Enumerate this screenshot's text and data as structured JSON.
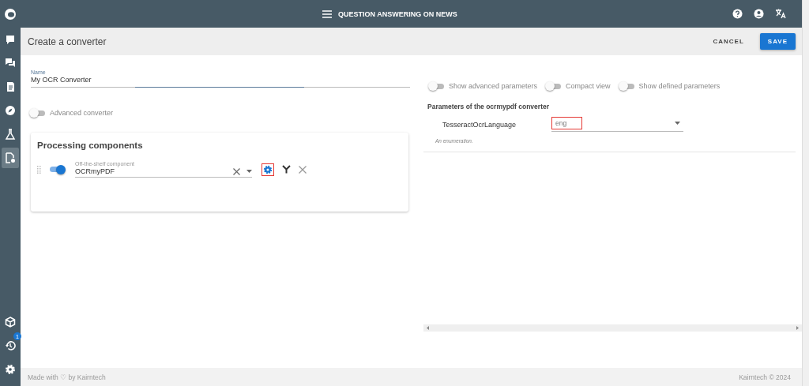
{
  "topbar": {
    "title": "QUESTION ANSWERING ON NEWS"
  },
  "sidebar": {
    "items": [
      {
        "kind": "question",
        "selected": false
      },
      {
        "kind": "chat",
        "selected": false
      },
      {
        "kind": "document",
        "selected": false
      },
      {
        "kind": "compass",
        "selected": false
      },
      {
        "kind": "flask",
        "selected": false
      },
      {
        "kind": "converter",
        "selected": true
      }
    ],
    "bottom_items": [
      {
        "kind": "cube"
      },
      {
        "kind": "history",
        "badge": "1"
      },
      {
        "kind": "settings"
      }
    ]
  },
  "header": {
    "title": "Create a converter",
    "buttons": [
      {
        "label": "CANCEL",
        "kind": "text"
      },
      {
        "label": "SAVE",
        "kind": "primary"
      }
    ]
  },
  "name_field": {
    "label": "Name",
    "value": "My OCR Converter"
  },
  "advanced_converter": {
    "label": "Advanced converter",
    "on": false
  },
  "processing": {
    "title": "Processing components",
    "components": [
      {
        "enabled": true,
        "label": "Off-the-shelf component",
        "value": "OCRmyPDF",
        "settings_highlighted": true
      }
    ]
  },
  "view_toggles": [
    {
      "label": "Show advanced parameters",
      "on": false
    },
    {
      "label": "Compact view",
      "on": false
    },
    {
      "label": "Show defined parameters",
      "on": false
    }
  ],
  "parameters": {
    "title": "Parameters of the ocrmypdf converter",
    "items": [
      {
        "name": "TesseractOcrLanguage",
        "value": "eng",
        "highlighted": true,
        "hint": "An enumeration."
      }
    ]
  },
  "footer": {
    "left": "Made with ♡ by Kairntech",
    "right": "Kairntech © 2024"
  }
}
